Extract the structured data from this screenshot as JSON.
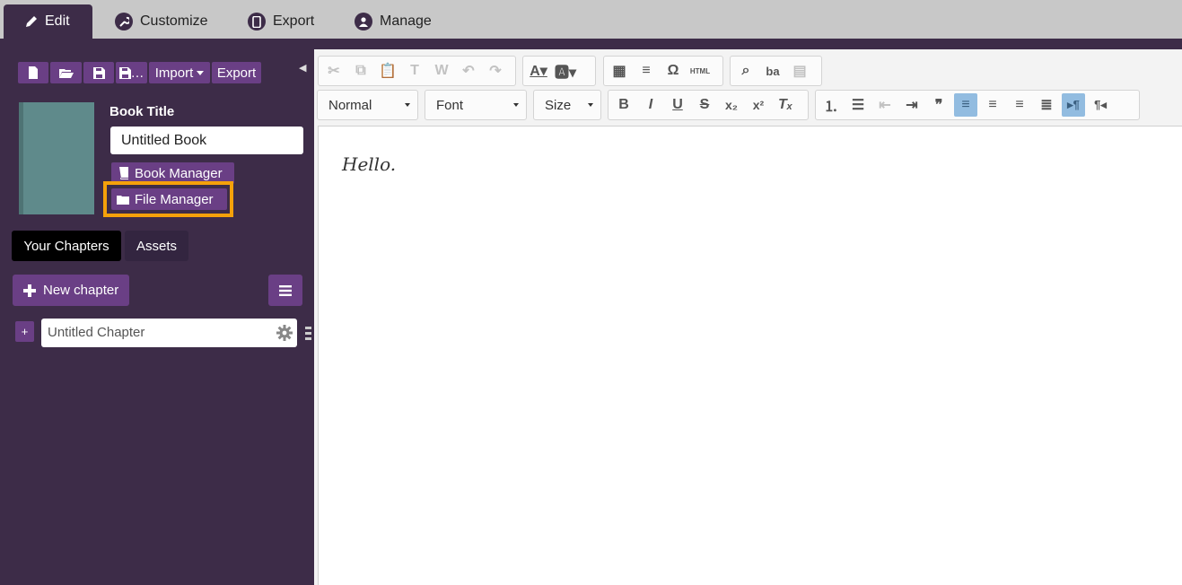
{
  "topnav": {
    "tabs": [
      {
        "label": "Edit",
        "icon": "pencil-icon",
        "active": true
      },
      {
        "label": "Customize",
        "icon": "wrench-icon"
      },
      {
        "label": "Export",
        "icon": "phone-icon"
      },
      {
        "label": "Manage",
        "icon": "user-icon"
      }
    ]
  },
  "sidebar": {
    "file_toolbar": {
      "icons": [
        "new-file-icon",
        "open-folder-icon",
        "save-icon",
        "save-as-icon"
      ],
      "save_as_suffix": "…",
      "import_label": "Import",
      "export_label": "Export"
    },
    "book_title_label": "Book Title",
    "book_title_value": "Untitled Book",
    "book_manager_label": "Book Manager",
    "file_manager_label": "File Manager",
    "tabs": [
      "Your Chapters",
      "Assets"
    ],
    "new_chapter_label": "New chapter",
    "chapters": [
      {
        "title": "Untitled Chapter"
      }
    ]
  },
  "editor": {
    "format_value": "Normal",
    "font_value": "Font",
    "size_value": "Size",
    "content_text": "Hello."
  },
  "colors": {
    "sidebar_bg": "#3d2c48",
    "button_purple": "#6a3f85",
    "highlight_orange": "#f5a10a",
    "active_align": "#92bce0"
  }
}
